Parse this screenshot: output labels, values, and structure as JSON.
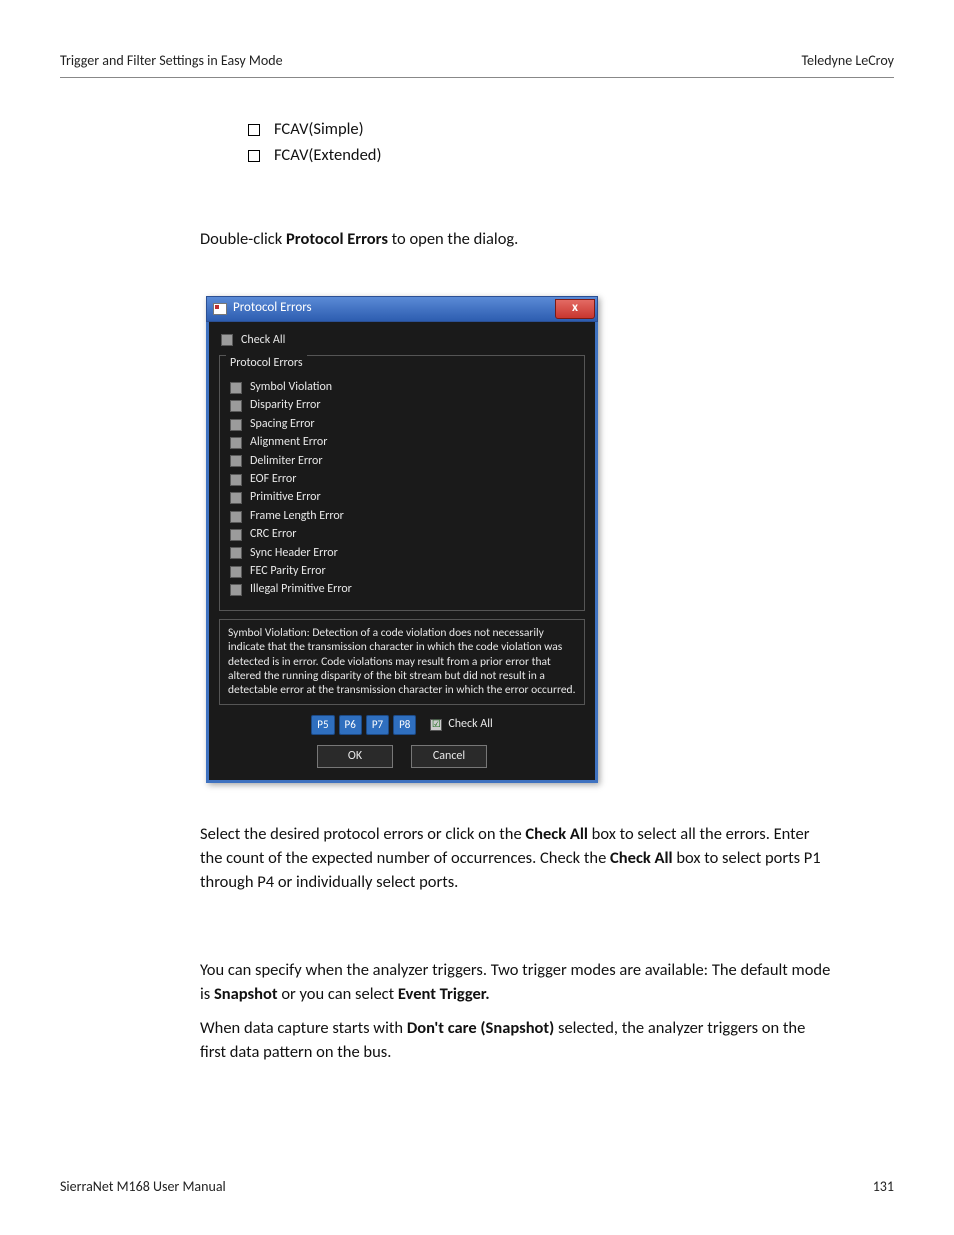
{
  "header": {
    "left": "Trigger and Filter Settings in Easy Mode",
    "right": "Teledyne LeCroy"
  },
  "bullets": {
    "b1": "FCAV(Simple)",
    "b2": "FCAV(Extended)"
  },
  "intro": {
    "t1": "Double-click ",
    "b1": "Protocol Errors",
    "t2": " to open the dialog."
  },
  "dialog": {
    "title": "Protocol Errors",
    "close": "x",
    "check_all": "Check All",
    "legend": "Protocol Errors",
    "errors": {
      "e0": "Symbol Violation",
      "e1": "Disparity Error",
      "e2": "Spacing Error",
      "e3": "Alignment Error",
      "e4": "Delimiter Error",
      "e5": "EOF Error",
      "e6": "Primitive Error",
      "e7": "Frame Length Error",
      "e8": "CRC Error",
      "e9": "Sync Header Error",
      "e10": "FEC Parity Error",
      "e11": "Illegal Primitive Error"
    },
    "desc": "Symbol Violation: Detection of a code violation does not necessarily indicate that the transmission character in which the code violation was detected is in error. Code violations may result from a prior error that altered the running disparity of the bit stream but did not result in a detectable error at the transmission character in which the error occurred.",
    "ports": {
      "p5": "P5",
      "p6": "P6",
      "p7": "P7",
      "p8": "P8",
      "check_all": "Check All",
      "mark": "☑"
    },
    "ok": "OK",
    "cancel": "Cancel"
  },
  "para2": {
    "t1": "Select the desired protocol errors or click on the ",
    "b1": "Check All",
    "t2": " box to select all the errors. Enter the count of the expected number of occurrences. Check the ",
    "b2": "Check All",
    "t3": " box to select ports P1 through P4 or individually select ports."
  },
  "para3": {
    "t1": "You can specify when the analyzer triggers. Two trigger modes are available: The default mode is ",
    "b1": "Snapshot",
    "t2": " or you can select ",
    "b2": "Event Trigger."
  },
  "para4": {
    "t1": "When data capture starts with ",
    "b1": "Don't care (Snapshot)",
    "t2": " selected, the analyzer triggers on the first data pattern on the bus."
  },
  "footer": {
    "left": "SierraNet M168 User Manual",
    "right": "131"
  }
}
